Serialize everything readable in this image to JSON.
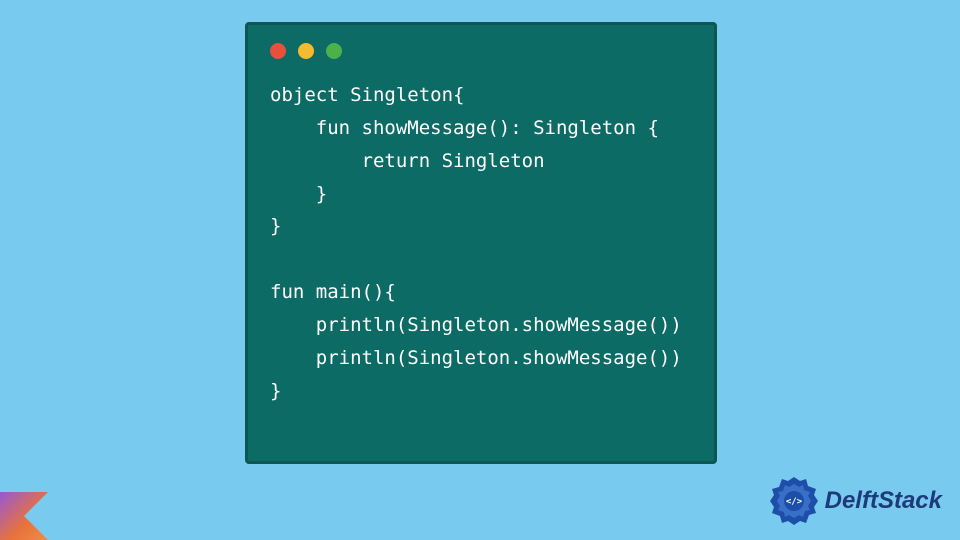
{
  "code": {
    "lines": [
      "object Singleton{",
      "    fun showMessage(): Singleton {",
      "        return Singleton",
      "    }",
      "}",
      "",
      "fun main(){",
      "    println(Singleton.showMessage())",
      "    println(Singleton.showMessage())",
      "}"
    ]
  },
  "brand": {
    "name": "DelftStack"
  },
  "window": {
    "dots": [
      "red",
      "yellow",
      "green"
    ]
  }
}
